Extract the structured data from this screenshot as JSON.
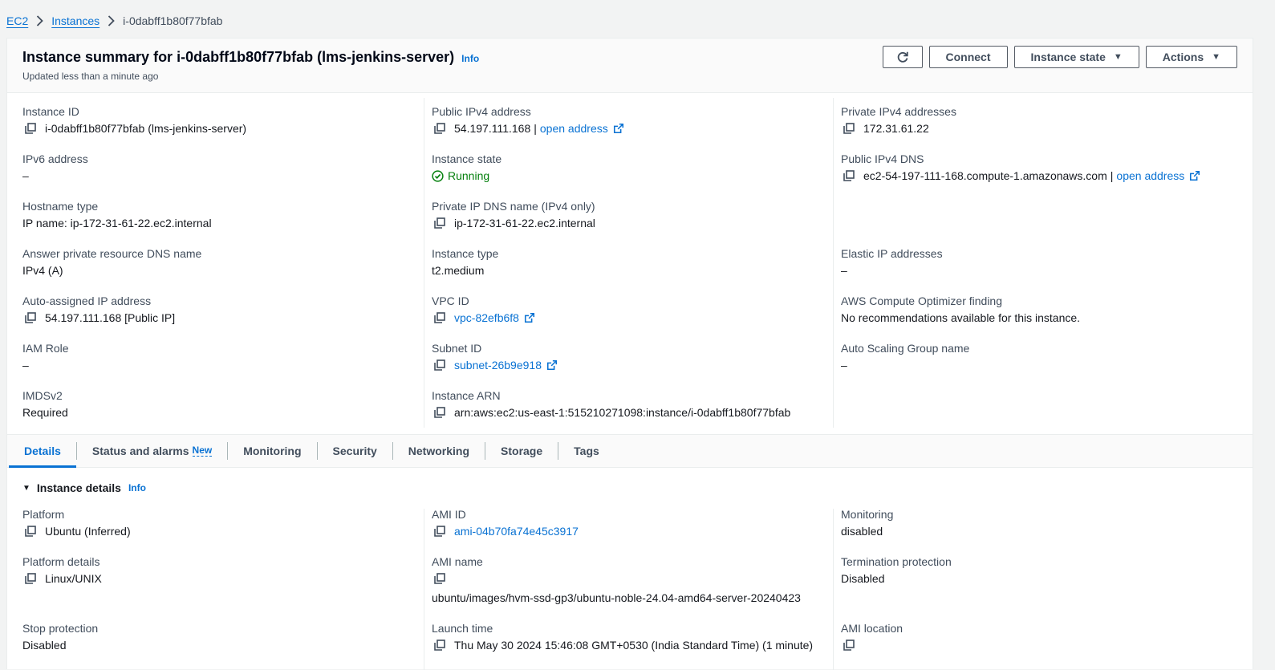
{
  "breadcrumb": {
    "ec2": "EC2",
    "instances": "Instances",
    "current": "i-0dabff1b80f77bfab"
  },
  "summary": {
    "title": "Instance summary for i-0dabff1b80f77bfab (lms-jenkins-server)",
    "info": "Info",
    "updated": "Updated less than a minute ago"
  },
  "buttons": {
    "connect": "Connect",
    "instance_state": "Instance state",
    "actions": "Actions"
  },
  "fields": {
    "instance_id": {
      "label": "Instance ID",
      "value": "i-0dabff1b80f77bfab (lms-jenkins-server)"
    },
    "public_ipv4": {
      "label": "Public IPv4 address",
      "value": "54.197.111.168",
      "link": "open address"
    },
    "private_ipv4": {
      "label": "Private IPv4 addresses",
      "value": "172.31.61.22"
    },
    "ipv6": {
      "label": "IPv6 address",
      "value": "–"
    },
    "instance_state": {
      "label": "Instance state",
      "value": "Running"
    },
    "public_dns": {
      "label": "Public IPv4 DNS",
      "value": "ec2-54-197-111-168.compute-1.amazonaws.com",
      "link": "open address"
    },
    "hostname_type": {
      "label": "Hostname type",
      "value": "IP name: ip-172-31-61-22.ec2.internal"
    },
    "private_dns": {
      "label": "Private IP DNS name (IPv4 only)",
      "value": "ip-172-31-61-22.ec2.internal"
    },
    "answer_dns": {
      "label": "Answer private resource DNS name",
      "value": "IPv4 (A)"
    },
    "instance_type": {
      "label": "Instance type",
      "value": "t2.medium"
    },
    "elastic_ip": {
      "label": "Elastic IP addresses",
      "value": "–"
    },
    "auto_ip": {
      "label": "Auto-assigned IP address",
      "value": "54.197.111.168 [Public IP]"
    },
    "vpc_id": {
      "label": "VPC ID",
      "value": "vpc-82efb6f8"
    },
    "optimizer": {
      "label": "AWS Compute Optimizer finding",
      "value": "No recommendations available for this instance."
    },
    "iam_role": {
      "label": "IAM Role",
      "value": "–"
    },
    "subnet_id": {
      "label": "Subnet ID",
      "value": "subnet-26b9e918"
    },
    "asg_name": {
      "label": "Auto Scaling Group name",
      "value": "–"
    },
    "imdsv2": {
      "label": "IMDSv2",
      "value": "Required"
    },
    "instance_arn": {
      "label": "Instance ARN",
      "value": "arn:aws:ec2:us-east-1:515210271098:instance/i-0dabff1b80f77bfab"
    }
  },
  "tabs": [
    {
      "label": "Details"
    },
    {
      "label": "Status and alarms",
      "badge": "New"
    },
    {
      "label": "Monitoring"
    },
    {
      "label": "Security"
    },
    {
      "label": "Networking"
    },
    {
      "label": "Storage"
    },
    {
      "label": "Tags"
    }
  ],
  "details": {
    "heading": "Instance details",
    "info": "Info",
    "platform": {
      "label": "Platform",
      "value": "Ubuntu (Inferred)"
    },
    "ami_id": {
      "label": "AMI ID",
      "value": "ami-04b70fa74e45c3917"
    },
    "monitoring": {
      "label": "Monitoring",
      "value": "disabled"
    },
    "platform_details": {
      "label": "Platform details",
      "value": "Linux/UNIX"
    },
    "ami_name": {
      "label": "AMI name",
      "value": "ubuntu/images/hvm-ssd-gp3/ubuntu-noble-24.04-amd64-server-20240423"
    },
    "termination": {
      "label": "Termination protection",
      "value": "Disabled"
    },
    "stop_protection": {
      "label": "Stop protection",
      "value": "Disabled"
    },
    "launch_time": {
      "label": "Launch time",
      "value": "Thu May 30 2024 15:46:08 GMT+0530 (India Standard Time) (1 minute)"
    },
    "ami_location": {
      "label": "AMI location"
    }
  }
}
